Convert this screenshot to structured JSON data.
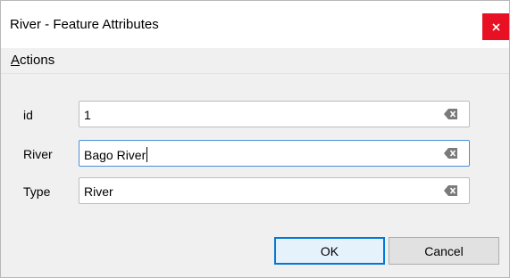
{
  "window": {
    "title": "River - Feature Attributes",
    "close_label": "x"
  },
  "menubar": {
    "actions": {
      "mnemonic": "A",
      "rest": "ctions"
    }
  },
  "fields": [
    {
      "label": "id",
      "value": "1",
      "clear_icon": "clear-backspace-icon"
    },
    {
      "label": "River",
      "value": "Bago River",
      "clear_icon": "clear-backspace-icon"
    },
    {
      "label": "Type",
      "value": "River",
      "clear_icon": "clear-backspace-icon"
    }
  ],
  "buttons": {
    "ok": "OK",
    "cancel": "Cancel"
  },
  "colors": {
    "close_button": "#e81123",
    "dialog_background": "#f0f0f0",
    "focus_border": "#4a90d9",
    "default_button_border": "#0078d7"
  }
}
